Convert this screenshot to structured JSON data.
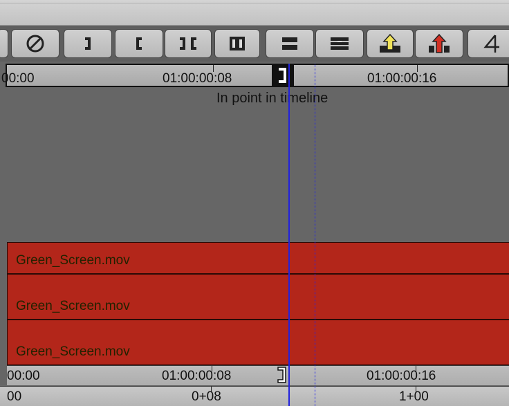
{
  "toolbar": {
    "buttons": [
      {
        "name": "partial-button",
        "icon": "unknown-left-icon"
      },
      {
        "name": "clear-marks-button",
        "icon": "circle-slash-icon"
      },
      {
        "name": "mark-out-button",
        "icon": "bracket-close-icon"
      },
      {
        "name": "mark-in-button",
        "icon": "bracket-open-icon"
      },
      {
        "name": "mark-clip-button",
        "icon": "mark-clip-icon"
      },
      {
        "name": "clear-in-out-button",
        "icon": "clear-in-out-icon"
      },
      {
        "name": "splice-in-button",
        "icon": "splice-in-icon"
      },
      {
        "name": "overwrite-button",
        "icon": "overwrite-icon"
      },
      {
        "name": "lift-button",
        "icon": "lift-icon"
      },
      {
        "name": "extract-button",
        "icon": "extract-icon"
      },
      {
        "name": "add-edit-button",
        "icon": "add-edit-icon"
      }
    ]
  },
  "timeline": {
    "top_ruler": {
      "tc0": "00:00",
      "tc1": "01:00:00:08",
      "tc2": "01:00:00:16"
    },
    "tooltip": "In point in timeline",
    "tracks": [
      {
        "name": "Green_Screen.mov"
      },
      {
        "name": "Green_Screen.mov"
      },
      {
        "name": "Green_Screen.mov"
      }
    ],
    "bottom_ruler": {
      "tc0": "00:00",
      "tc1": "01:00:00:08",
      "tc2": "01:00:00:16"
    },
    "frame_ruler": {
      "f0": "00",
      "f1": "0+08",
      "f2": "1+00"
    }
  },
  "colors": {
    "track": "#b3261a",
    "position_line": "#2222dd",
    "background": "#666666"
  }
}
